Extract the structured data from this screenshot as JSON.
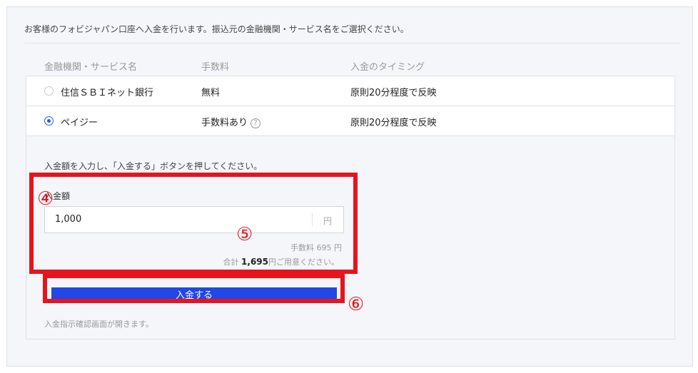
{
  "intro_text": "お客様のフォビジャパン口座へ入金を行います。振込元の金融機関・サービス名をご選択ください。",
  "columns": {
    "service": "金融機関・サービス名",
    "fee": "手数料",
    "timing": "入金のタイミング"
  },
  "methods": [
    {
      "name": "住信ＳＢＩネット銀行",
      "fee": "無料",
      "timing": "原則20分程度で反映",
      "selected": false
    },
    {
      "name": "ペイジー",
      "fee": "手数料あり",
      "timing": "原則20分程度で反映",
      "selected": true
    }
  ],
  "help_icon": "?",
  "instruction": "入金額を入力し、「入金する」ボタンを押してください。",
  "amount": {
    "label": "入金額",
    "value": "1,000",
    "unit": "円"
  },
  "fee_line": "手数料 695 円",
  "total": {
    "prefix": "合計",
    "amount": "1,695",
    "suffix": "円ご用意ください。"
  },
  "submit_label": "入金する",
  "note": "入金指示確認画面が開きます。",
  "annotations": [
    "④",
    "⑤",
    "⑥"
  ],
  "colors": {
    "accent": "#2247e8",
    "highlight": "#e5141d",
    "radio": "#2a5bd7"
  }
}
